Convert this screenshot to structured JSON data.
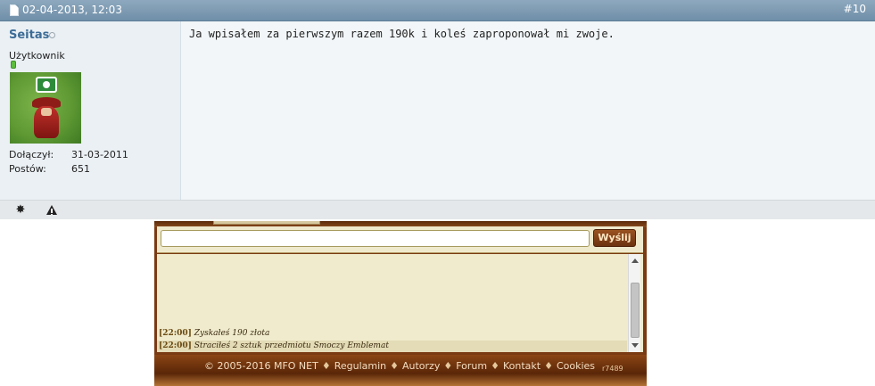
{
  "post": {
    "header": {
      "date": "02-04-2013, 12:03",
      "number": "#10",
      "icons": {
        "post": "document-icon"
      }
    },
    "user": {
      "name": "Seitas",
      "title": "Użytkownik",
      "stats": [
        {
          "label": "Dołączył:",
          "value": "31-03-2011"
        },
        {
          "label": "Postów:",
          "value": "651"
        }
      ],
      "colors": {
        "name": "#3c6c97",
        "reputation": "#5cbf3c"
      }
    },
    "message": "Ja wpisałem za pierwszym razem 190k i koleś zaproponował mi zwoje.",
    "footer_icons": [
      "star-icon",
      "warning-icon"
    ]
  },
  "game": {
    "chat": {
      "input_value": "",
      "send_label": "Wyślij"
    },
    "log": [
      {
        "time": "[22:00]",
        "text": " Zyskałeś 190 złota"
      },
      {
        "time": "[22:00]",
        "text": " Straciłeś 2 sztuk przedmiotu Smoczy Emblemat"
      }
    ],
    "footer": {
      "copyright": "© 2005-2016 MFO NET",
      "links": [
        "Regulamin",
        "Autorzy",
        "Forum",
        "Kontakt",
        "Cookies"
      ],
      "separator": "♦",
      "version": "r7489"
    },
    "colors": {
      "frame": "#7a3a12",
      "panel": "#f0ebcc",
      "button": "#8a4518"
    }
  },
  "colors": {
    "header_bar": "#7f9db5",
    "post_bg": "#f2f6f8",
    "userinfo_bg": "#eaf0f4"
  }
}
